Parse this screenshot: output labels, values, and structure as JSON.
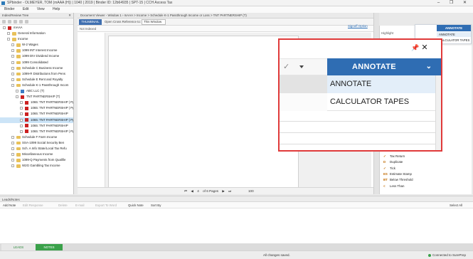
{
  "window": {
    "title": "SPbinder - OLMEYER, TOM (mAAA (H)) | 1040 | 2019 | Binder ID: 12b64935 | SPT-15 | CCH Axcess Tax",
    "controls": "–  ❐  ✕"
  },
  "menu": [
    "Binder",
    "Edit",
    "View",
    "Help"
  ],
  "index_tree": {
    "header": "Index/Review Tree",
    "items": [
      {
        "label": "mAAA",
        "indent": 0,
        "type": "doc"
      },
      {
        "label": "General Information",
        "indent": 1,
        "type": "folder"
      },
      {
        "label": "Income",
        "indent": 1,
        "type": "folder"
      },
      {
        "label": "W-2 Wages",
        "indent": 2,
        "type": "folder"
      },
      {
        "label": "1099 INT Interest Income",
        "indent": 2,
        "type": "folder"
      },
      {
        "label": "1099 DIV Dividend Income",
        "indent": 2,
        "type": "folder"
      },
      {
        "label": "1099 Consolidated",
        "indent": 2,
        "type": "folder"
      },
      {
        "label": "Schedule C Business Income",
        "indent": 2,
        "type": "folder"
      },
      {
        "label": "1099-R  Distributions from Pens",
        "indent": 2,
        "type": "folder"
      },
      {
        "label": "Schedule E  Rent and Royalty",
        "indent": 2,
        "type": "folder"
      },
      {
        "label": "Schedule K-1 Passthrough Incom",
        "indent": 2,
        "type": "folder"
      },
      {
        "label": "ABC LLC (T)",
        "indent": 3,
        "type": "doc-blue"
      },
      {
        "label": "TNT PARTNERSHIP (T)",
        "indent": 3,
        "type": "doc"
      },
      {
        "label": "1065: TNT PARTNERSHIP | Pg",
        "indent": 4,
        "type": "doc"
      },
      {
        "label": "1065: TNT PARTNERSHIP | Pg",
        "indent": 4,
        "type": "doc"
      },
      {
        "label": "1065: TNT PARTNERSHIP",
        "indent": 4,
        "type": "doc"
      },
      {
        "label": "1065: TNT PARTNERSHIP | Pg",
        "indent": 4,
        "type": "doc",
        "selected": true
      },
      {
        "label": "1065: TNT PARTNERSHIP",
        "indent": 4,
        "type": "doc"
      },
      {
        "label": "1065: TNT PARTNERSHIP | Pg",
        "indent": 4,
        "type": "doc"
      },
      {
        "label": "Schedule F Farm Income",
        "indent": 2,
        "type": "folder"
      },
      {
        "label": "SSA-1099 Social Security Ben",
        "indent": 2,
        "type": "folder"
      },
      {
        "label": "Sch. A Info State/Local Tax Refu",
        "indent": 2,
        "type": "folder"
      },
      {
        "label": "Miscellaneous Income",
        "indent": 2,
        "type": "folder"
      },
      {
        "label": "1099-Q Payments from Qualifie",
        "indent": 2,
        "type": "folder"
      },
      {
        "label": "W2G Gambling Tax Income",
        "indent": 2,
        "type": "folder"
      }
    ],
    "tabs": [
      "INDEX TREE",
      "REVIEW TREE"
    ]
  },
  "document_viewer": {
    "header": "Document Viewer - Window 1  ›  mAAA > Income > Schedule K-1 Passthrough Income or Loss > TNT PARTNERSHIP (T)",
    "thumbnail_tab": "THUMBNAIL",
    "cross_ref_label": "Open Cross Reference to:",
    "cross_ref_value": "This Window",
    "not_indexed": "Not Indexed",
    "pager": {
      "page": "4",
      "of_pages": "of 6 Pages",
      "zoom": "100"
    }
  },
  "right_panel": {
    "links": "Signoff  Option",
    "highlight": "Highlight",
    "stamps": [
      {
        "sym": "✓",
        "label": "Tax Return"
      },
      {
        "sym": "D",
        "label": "Duplicate"
      },
      {
        "sym": "✓",
        "label": "Tick"
      },
      {
        "sym": "ES",
        "label": "Estimate Stamp"
      },
      {
        "sym": "BT",
        "label": "Below Threshold"
      },
      {
        "sym": "<",
        "label": "Less Than"
      }
    ]
  },
  "annotate_dropdown": {
    "button": "ANNOTATE",
    "options": [
      "ANNOTATE",
      "CALCULATOR TAPES"
    ]
  },
  "leads": {
    "header": "Leads/Notes",
    "toolbar": {
      "add_note": "Add Note",
      "edit_response": "Edit Response",
      "delete": "Delete",
      "email": "E-mail",
      "export": "Export To Word",
      "quick_note": "Quick Note",
      "sort_by": "Sort By",
      "select_all": "Select All"
    },
    "tabs": [
      "LEADS",
      "NOTES"
    ]
  },
  "status": {
    "saved": "All changes saved.",
    "connection": "Connected to SurePrep"
  },
  "colors": {
    "accent": "#2f6db3",
    "highlight": "#e03a3a",
    "green": "#3aa14a"
  }
}
